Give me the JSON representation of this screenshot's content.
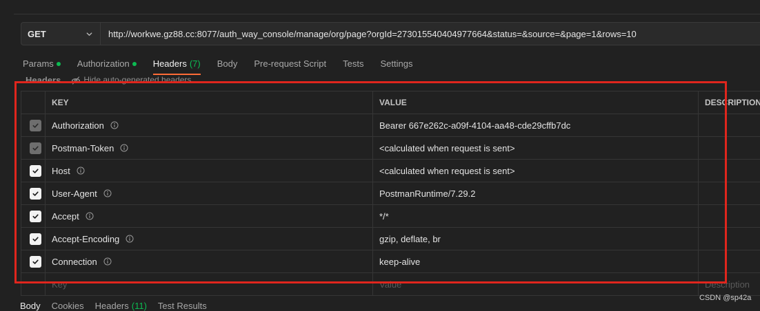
{
  "request": {
    "method": "GET",
    "url": "http://workwe.gz88.cc:8077/auth_way_console/manage/org/page?orgId=273015540404977664&status=&source=&page=1&rows=10"
  },
  "tabs": [
    {
      "label": "Params",
      "indicator": true
    },
    {
      "label": "Authorization",
      "indicator": true
    },
    {
      "label": "Headers",
      "count": "(7)",
      "active": true
    },
    {
      "label": "Body"
    },
    {
      "label": "Pre-request Script"
    },
    {
      "label": "Tests"
    },
    {
      "label": "Settings"
    }
  ],
  "headers_section": {
    "title": "Headers",
    "toggle_label": "Hide auto-generated headers",
    "toggle_icon": "eye-slash-icon"
  },
  "table": {
    "columns": [
      "KEY",
      "VALUE",
      "DESCRIPTION"
    ],
    "rows": [
      {
        "key": "Authorization",
        "value": "Bearer 667e262c-a09f-4104-aa48-cde29cffb7dc",
        "checked": true,
        "locked": true
      },
      {
        "key": "Postman-Token",
        "value": "<calculated when request is sent>",
        "checked": true,
        "locked": true
      },
      {
        "key": "Host",
        "value": "<calculated when request is sent>",
        "checked": true,
        "locked": false
      },
      {
        "key": "User-Agent",
        "value": "PostmanRuntime/7.29.2",
        "checked": true,
        "locked": false
      },
      {
        "key": "Accept",
        "value": "*/*",
        "checked": true,
        "locked": false
      },
      {
        "key": "Accept-Encoding",
        "value": "gzip, deflate, br",
        "checked": true,
        "locked": false
      },
      {
        "key": "Connection",
        "value": "keep-alive",
        "checked": true,
        "locked": false
      }
    ],
    "placeholder": {
      "key": "Key",
      "value": "Value",
      "description": "Description"
    }
  },
  "response_tabs": [
    {
      "label": "Body",
      "active": true
    },
    {
      "label": "Cookies"
    },
    {
      "label": "Headers",
      "count": "(11)"
    },
    {
      "label": "Test Results"
    }
  ],
  "watermark": "CSDN @sp42a",
  "colors": {
    "accent": "#ff6c37",
    "green": "#0cbb52",
    "highlight": "#e0261d",
    "background": "#212121"
  }
}
